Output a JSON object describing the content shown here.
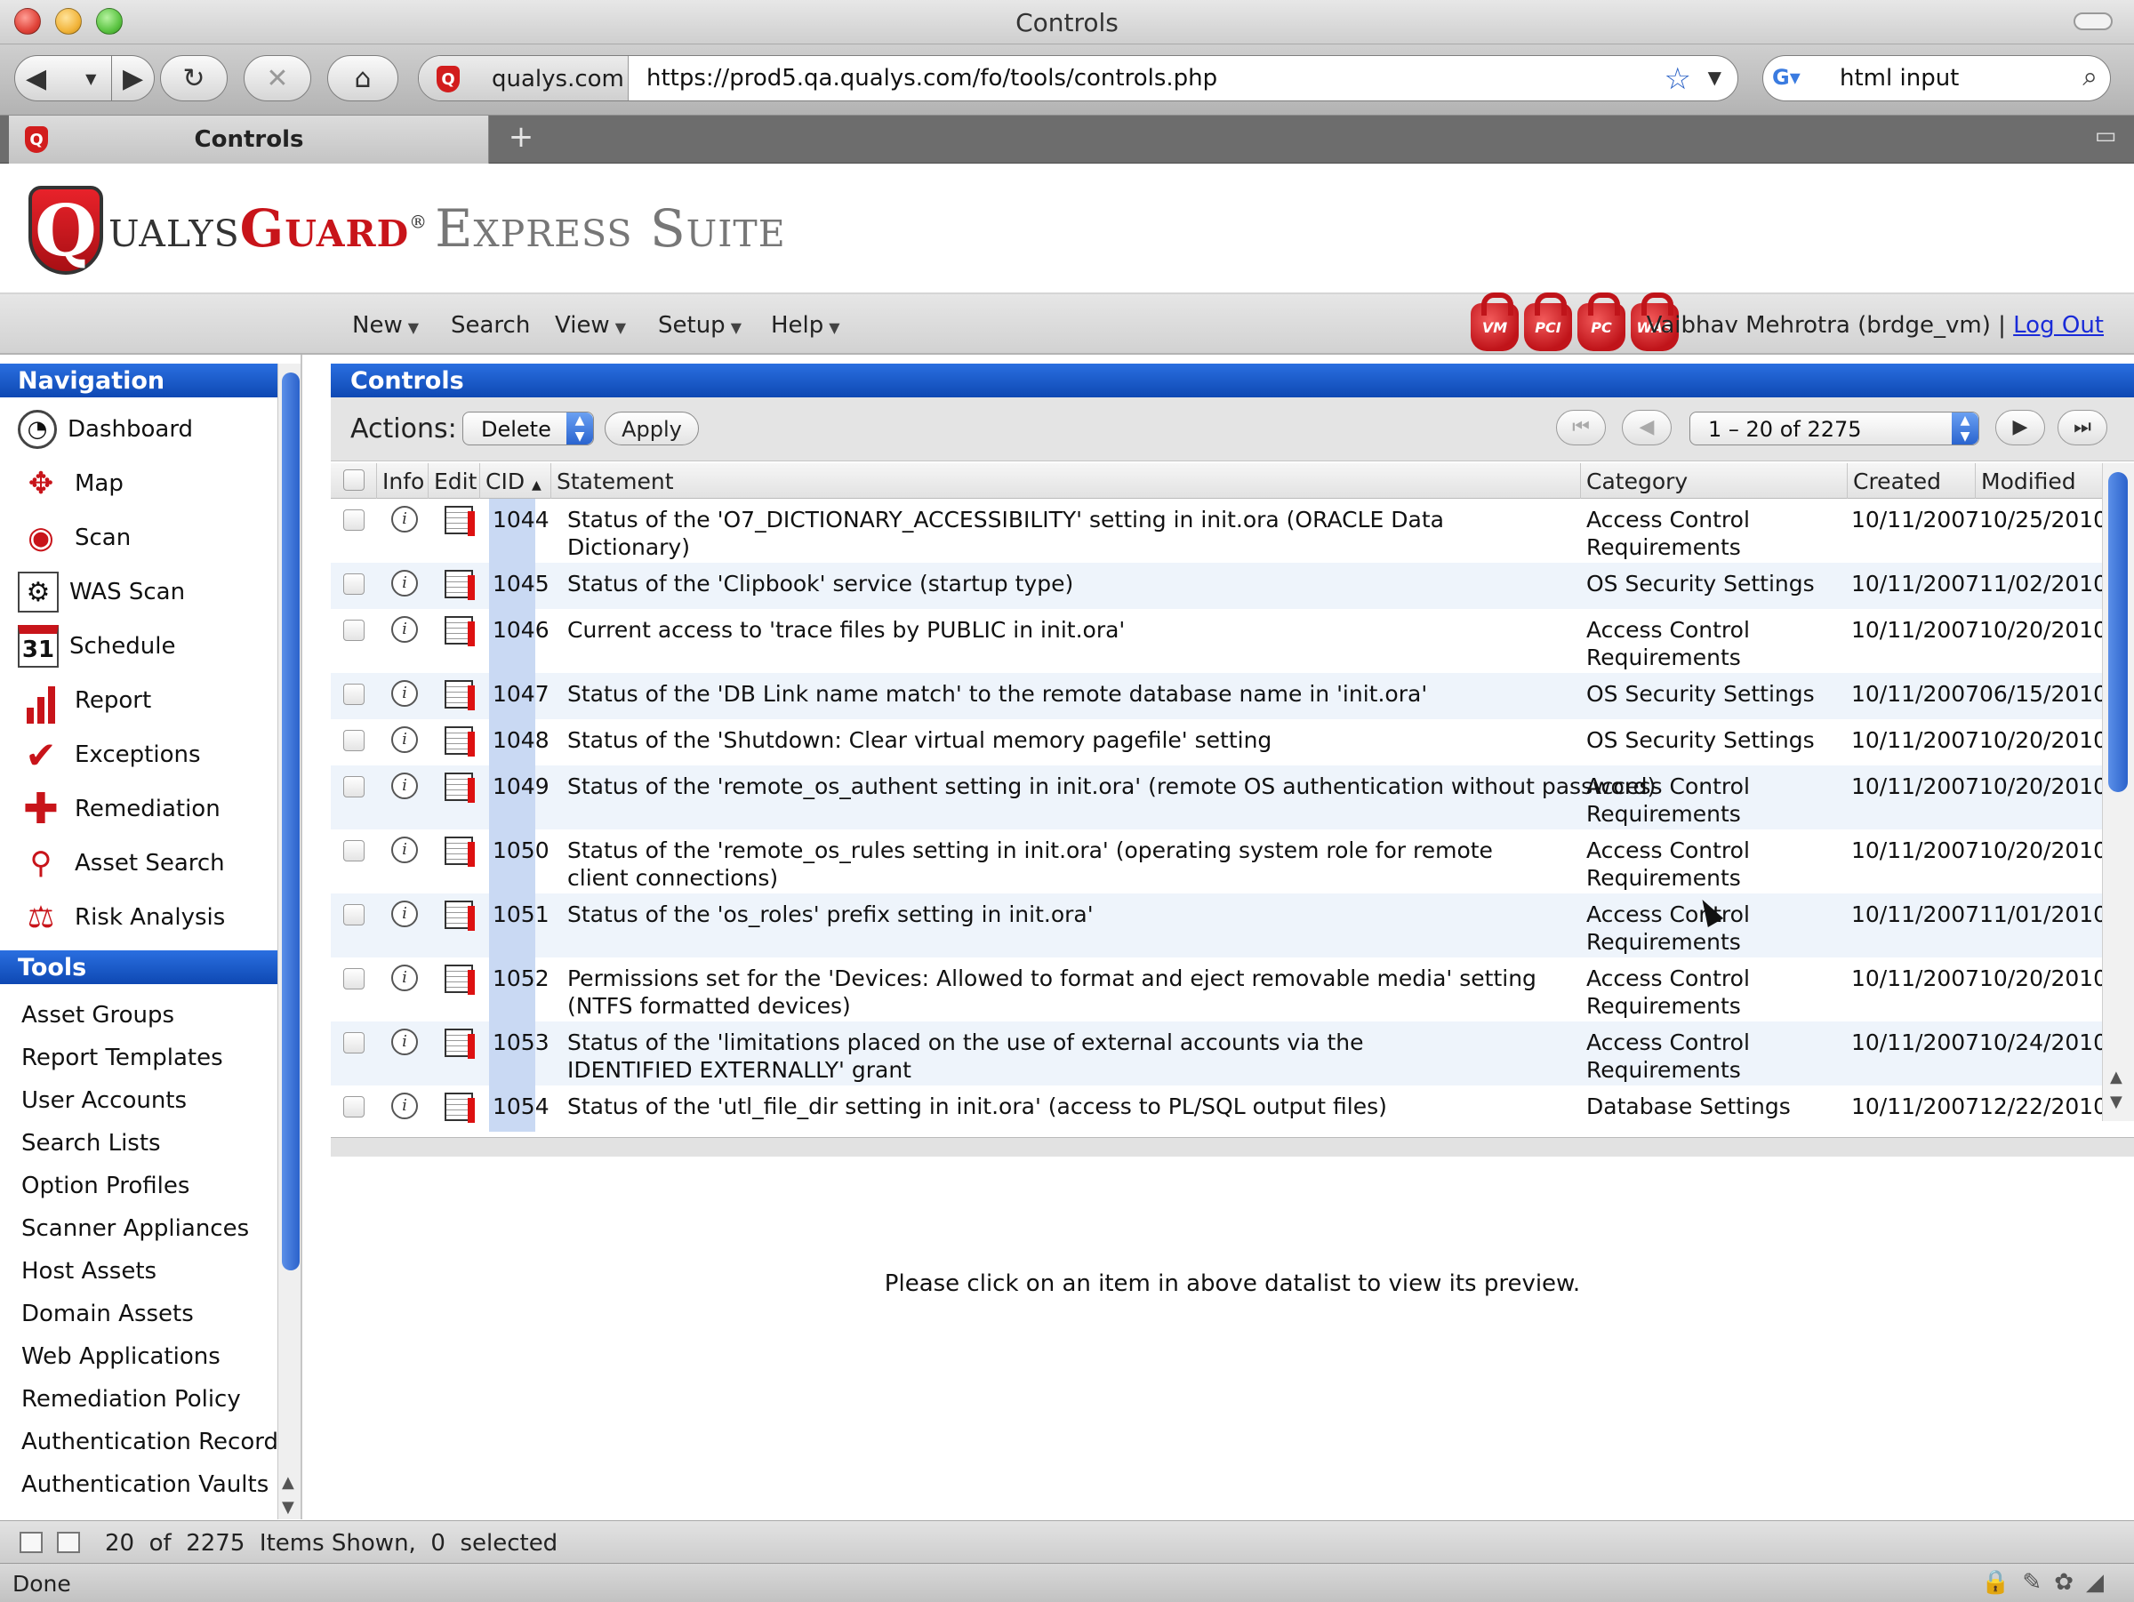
{
  "browser": {
    "window_title": "Controls",
    "site_name": "qualys.com",
    "url": "https://prod5.qa.qualys.com/fo/tools/controls.php",
    "search_value": "html input",
    "tab_label": "Controls",
    "new_tab": "+",
    "status": "Done"
  },
  "header": {
    "logo_shield": "Q",
    "logo_qualys": "ualys",
    "logo_guard": "Guard",
    "logo_reg": "®",
    "logo_suite": "Express Suite"
  },
  "menu": {
    "items": [
      "New",
      "Search",
      "View",
      "Setup",
      "Help"
    ],
    "locks": [
      "VM",
      "PCI",
      "PC",
      "WAS"
    ],
    "user": "Vaibhav Mehrotra (brdge_vm) |",
    "logout": "Log Out"
  },
  "sidebar": {
    "nav_title": "Navigation",
    "nav_items": [
      {
        "label": "Dashboard",
        "icon": "dashboard-gauge-icon"
      },
      {
        "label": "Map",
        "icon": "map-arrows-icon"
      },
      {
        "label": "Scan",
        "icon": "scan-eye-icon"
      },
      {
        "label": "WAS Scan",
        "icon": "was-gear-icon"
      },
      {
        "label": "Schedule",
        "icon": "calendar-icon"
      },
      {
        "label": "Report",
        "icon": "bar-chart-icon"
      },
      {
        "label": "Exceptions",
        "icon": "checkmark-icon"
      },
      {
        "label": "Remediation",
        "icon": "red-cross-icon"
      },
      {
        "label": "Asset Search",
        "icon": "asset-search-icon"
      },
      {
        "label": "Risk Analysis",
        "icon": "scales-icon"
      }
    ],
    "calendar_day": "31",
    "tools_title": "Tools",
    "tool_items": [
      "Asset Groups",
      "Report Templates",
      "User Accounts",
      "Search Lists",
      "Option Profiles",
      "Scanner Appliances",
      "Host Assets",
      "Domain Assets",
      "Web Applications",
      "Remediation Policy",
      "Authentication Records",
      "Authentication Vaults"
    ]
  },
  "main": {
    "title": "Controls",
    "actions_label": "Actions:",
    "action_selected": "Delete",
    "apply_label": "Apply",
    "page_range": "1 – 20 of 2275",
    "columns": {
      "info": "Info",
      "edit": "Edit",
      "cid": "CID",
      "statement": "Statement",
      "category": "Category",
      "created": "Created",
      "modified": "Modified"
    },
    "sort_indicator": "▲",
    "rows": [
      {
        "cid": "1044",
        "statement": "Status of the 'O7_DICTIONARY_ACCESSIBILITY' setting in init.ora (ORACLE Data Dictionary)",
        "category": "Access Control Requirements",
        "created": "10/11/2007",
        "modified": "10/25/2010"
      },
      {
        "cid": "1045",
        "statement": "Status of the 'Clipbook' service (startup type)",
        "category": "OS Security Settings",
        "created": "10/11/2007",
        "modified": "11/02/2010"
      },
      {
        "cid": "1046",
        "statement": "Current access to 'trace files by PUBLIC in init.ora'",
        "category": "Access Control Requirements",
        "created": "10/11/2007",
        "modified": "10/20/2010"
      },
      {
        "cid": "1047",
        "statement": "Status of the 'DB Link name match' to the remote database name in 'init.ora'",
        "category": "OS Security Settings",
        "created": "10/11/2007",
        "modified": "06/15/2010"
      },
      {
        "cid": "1048",
        "statement": "Status of the 'Shutdown: Clear virtual memory pagefile' setting",
        "category": "OS Security Settings",
        "created": "10/11/2007",
        "modified": "10/20/2010"
      },
      {
        "cid": "1049",
        "statement": "Status of the 'remote_os_authent setting in init.ora' (remote OS authentication without password)",
        "category": "Access Control Requirements",
        "created": "10/11/2007",
        "modified": "10/20/2010"
      },
      {
        "cid": "1050",
        "statement": "Status of the 'remote_os_rules setting in init.ora' (operating system role for remote client connections)",
        "category": "Access Control Requirements",
        "created": "10/11/2007",
        "modified": "10/20/2010"
      },
      {
        "cid": "1051",
        "statement": "Status of the 'os_roles' prefix setting in init.ora'",
        "category": "Access Control Requirements",
        "created": "10/11/2007",
        "modified": "11/01/2010"
      },
      {
        "cid": "1052",
        "statement": "Permissions set for the 'Devices: Allowed to format and eject removable media' setting (NTFS formatted devices)",
        "category": "Access Control Requirements",
        "created": "10/11/2007",
        "modified": "10/20/2010"
      },
      {
        "cid": "1053",
        "statement": "Status of the 'limitations placed on the use of external accounts via the IDENTIFIED EXTERNALLY' grant",
        "category": "Access Control Requirements",
        "created": "10/11/2007",
        "modified": "10/24/2010"
      },
      {
        "cid": "1054",
        "statement": "Status of the 'utl_file_dir setting in init.ora' (access to PL/SQL output files)",
        "category": "Database Settings",
        "created": "10/11/2007",
        "modified": "12/22/2010"
      }
    ],
    "preview_message": "Please click on an item in above datalist to view its preview."
  },
  "status_bar": {
    "shown": "20",
    "of_label": "of",
    "total": "2275",
    "items_label": "Items Shown,",
    "selected_count": "0",
    "selected_label": "selected"
  }
}
